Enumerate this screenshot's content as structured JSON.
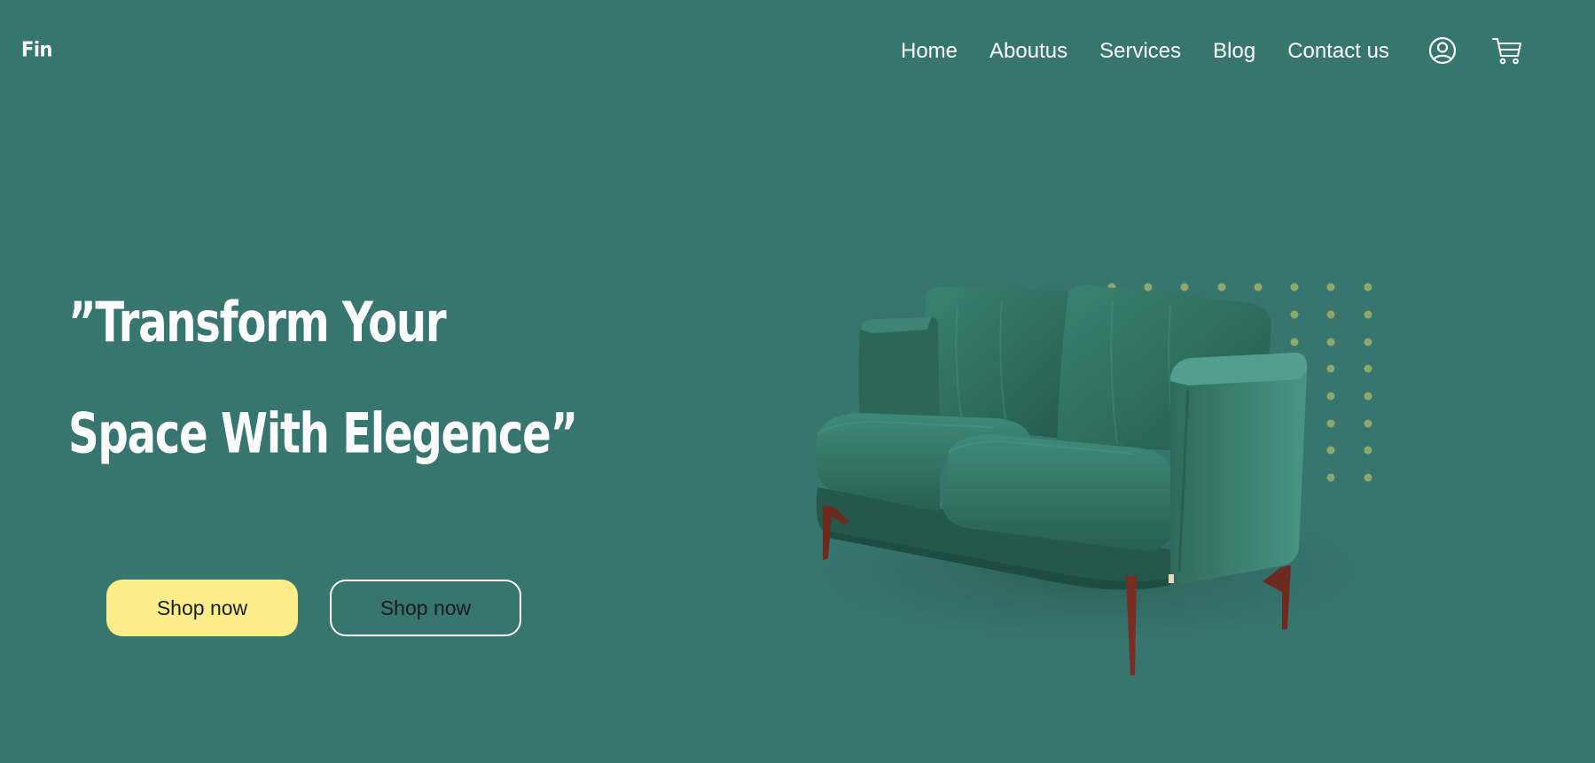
{
  "header": {
    "logo": "Fin",
    "nav": [
      {
        "label": "Home"
      },
      {
        "label": "Aboutus"
      },
      {
        "label": "Services"
      },
      {
        "label": "Blog"
      },
      {
        "label": "Contact us"
      }
    ],
    "icons": [
      "user-icon",
      "cart-icon"
    ]
  },
  "hero": {
    "title_line1": "”Transform Your",
    "title_line2": "Space With Elegence”",
    "primary_button": "Shop now",
    "secondary_button": "Shop now"
  },
  "colors": {
    "background": "#37756f",
    "primary_button": "#fbee88",
    "sofa": "#2f6b5c",
    "dots": "#8fa86a"
  }
}
